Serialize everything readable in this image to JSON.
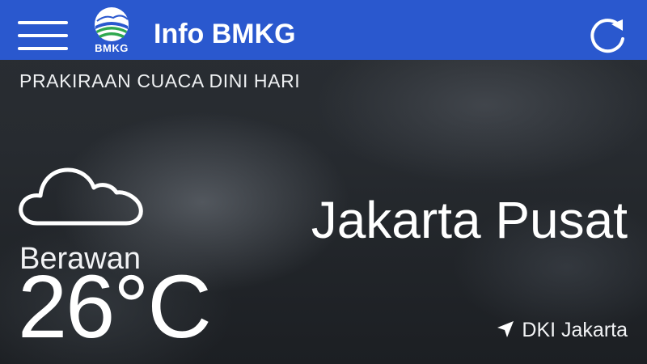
{
  "app": {
    "title": "Info BMKG",
    "logo_text": "BMKG",
    "accent_color": "#2a58ce"
  },
  "header": {
    "menu_icon": "hamburger-menu-icon",
    "refresh_icon": "refresh-icon"
  },
  "forecast": {
    "period_label": "PRAKIRAAN CUACA DINI HARI",
    "condition": "Berawan",
    "condition_icon": "cloud-icon",
    "temperature": "26°C"
  },
  "location": {
    "city": "Jakarta Pusat",
    "province": "DKI Jakarta",
    "icon": "location-arrow-icon"
  }
}
